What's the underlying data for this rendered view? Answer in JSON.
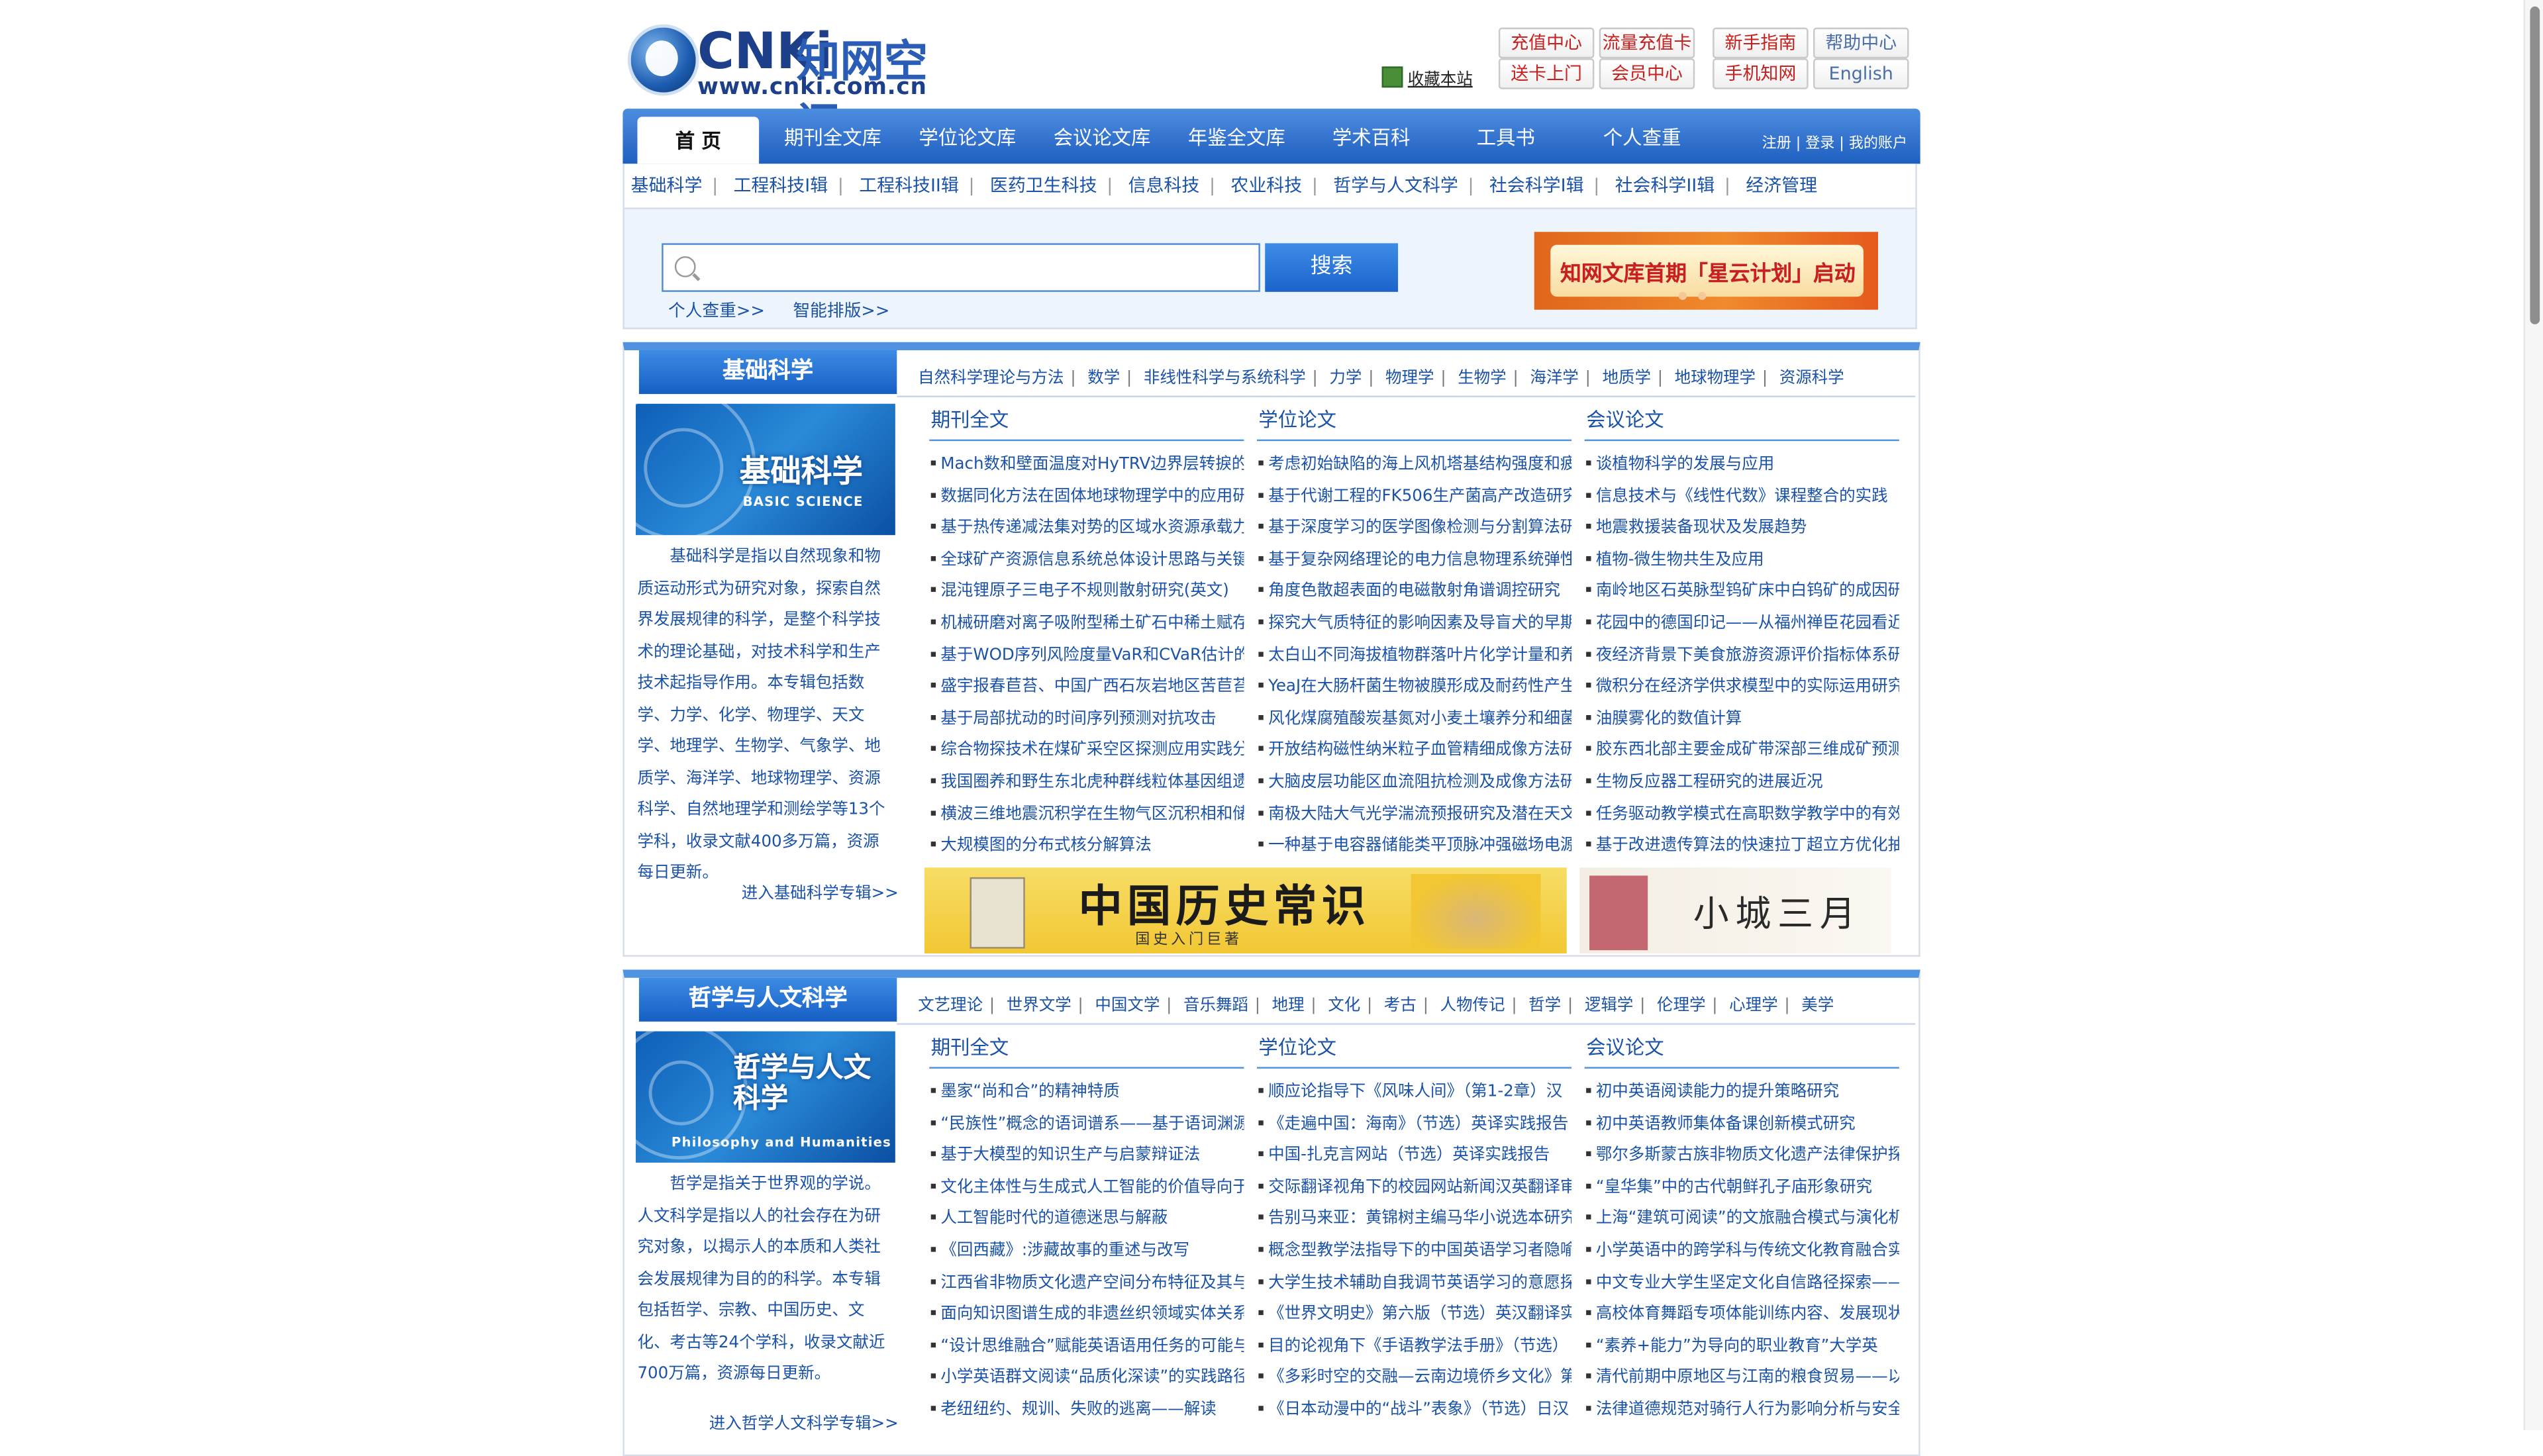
{
  "logo": {
    "word": "CNKi",
    "cn": "知网空间",
    "url": "www.cnki.com.cn"
  },
  "favorite": "收藏本站",
  "top_buttons": [
    {
      "label": "充值中心",
      "style": "red"
    },
    {
      "label": "流量充值卡",
      "style": "red"
    },
    {
      "label": "新手指南",
      "style": "red"
    },
    {
      "label": "帮助中心",
      "style": "blue"
    },
    {
      "label": "送卡上门",
      "style": "red"
    },
    {
      "label": "会员中心",
      "style": "red"
    },
    {
      "label": "手机知网",
      "style": "red"
    },
    {
      "label": "English",
      "style": "blue"
    }
  ],
  "nav": {
    "home": "首 页",
    "items": [
      "期刊全文库",
      "学位论文库",
      "会议论文库",
      "年鉴全文库",
      "学术百科",
      "工具书",
      "个人查重"
    ],
    "register": "注册",
    "login": "登录",
    "account": "我的账户"
  },
  "subnav": [
    "基础科学",
    "工程科技I辑",
    "工程科技II辑",
    "医药卫生科技",
    "信息科技",
    "农业科技",
    "哲学与人文科学",
    "社会科学I辑",
    "社会科学II辑",
    "经济管理"
  ],
  "search": {
    "button": "搜索",
    "links": [
      "个人查重>>",
      "智能排版>>"
    ]
  },
  "banner": {
    "text": "知网文库首期「星云计划」启动"
  },
  "sections": [
    {
      "title": "基础科学",
      "image_title": "基础科学",
      "image_sub": "BASIC SCIENCE",
      "tags": [
        "自然科学理论与方法",
        "数学",
        "非线性科学与系统科学",
        "力学",
        "物理学",
        "生物学",
        "海洋学",
        "地质学",
        "地球物理学",
        "资源科学"
      ],
      "desc": "基础科学是指以自然现象和物质运动形式为研究对象，探索自然界发展规律的科学，是整个科学技术的理论基础，对技术科学和生产技术起指导作用。本专辑包括数学、力学、化学、物理学、天文学、地理学、生物学、气象学、地质学、海洋学、地球物理学、资源科学、自然地理学和测绘学等13个学科，收录文献400多万篇，资源每日更新。",
      "more": "进入基础科学专辑>>",
      "columns": [
        {
          "heading": "期刊全文",
          "items": [
            "Mach数和壁面温度对HyTRV边界层转捩的",
            "数据同化方法在固体地球物理学中的应用研",
            "基于热传递减法集对势的区域水资源承载力",
            "全球矿产资源信息系统总体设计思路与关键",
            "混沌锂原子三电子不规则散射研究(英文)",
            "机械研磨对离子吸附型稀土矿石中稀土赋存",
            "基于WOD序列风险度量VaR和CVaR估计的",
            "盛宇报春苣苔、中国广西石灰岩地区苦苣苔",
            "基于局部扰动的时间序列预测对抗攻击",
            "综合物探技术在煤矿采空区探测应用实践分",
            "我国圈养和野生东北虎种群线粒体基因组遗",
            "横波三维地震沉积学在生物气区沉积相和储",
            "大规模图的分布式核分解算法"
          ]
        },
        {
          "heading": "学位论文",
          "items": [
            "考虑初始缺陷的海上风机塔基结构强度和疲",
            "基于代谢工程的FK506生产菌高产改造研究",
            "基于深度学习的医学图像检测与分割算法研",
            "基于复杂网络理论的电力信息物理系统弹性",
            "角度色散超表面的电磁散射角谱调控研究",
            "探究大气质特征的影响因素及导盲犬的早期",
            "太白山不同海拔植物群落叶片化学计量和养",
            "YeaJ在大肠杆菌生物被膜形成及耐药性产生",
            "风化煤腐殖酸炭基氮对小麦土壤养分和细菌",
            "开放结构磁性纳米粒子血管精细成像方法研",
            "大脑皮层功能区血流阻抗检测及成像方法研",
            "南极大陆大气光学湍流预报研究及潜在天文",
            "一种基于电容器储能类平顶脉冲强磁场电源"
          ]
        },
        {
          "heading": "会议论文",
          "items": [
            "谈植物科学的发展与应用",
            "信息技术与《线性代数》课程整合的实践",
            "地震救援装备现状及发展趋势",
            "植物-微生物共生及应用",
            "南岭地区石英脉型钨矿床中白钨矿的成因研",
            "花园中的德国印记——从福州禅臣花园看近",
            "夜经济背景下美食旅游资源评价指标体系研",
            "微积分在经济学供求模型中的实际运用研究",
            "油膜雾化的数值计算",
            "胶东西北部主要金成矿带深部三维成矿预测",
            "生物反应器工程研究的进展近况",
            "任务驱动教学模式在高职数学教学中的有效",
            "基于改进遗传算法的快速拉丁超立方优化抽"
          ]
        }
      ],
      "ads": [
        {
          "title": "中国历史常识",
          "sub": "国史入门巨著"
        },
        {
          "title": "小城三月"
        }
      ]
    },
    {
      "title": "哲学与人文科学",
      "image_title": "哲学与人文科学",
      "image_sub": "Philosophy and Humanities",
      "tags": [
        "文艺理论",
        "世界文学",
        "中国文学",
        "音乐舞蹈",
        "地理",
        "文化",
        "考古",
        "人物传记",
        "哲学",
        "逻辑学",
        "伦理学",
        "心理学",
        "美学"
      ],
      "desc": "哲学是指关于世界观的学说。人文科学是指以人的社会存在为研究对象，以揭示人的本质和人类社会发展规律为目的的科学。本专辑包括哲学、宗教、中国历史、文化、考古等24个学科，收录文献近700万篇，资源每日更新。",
      "more": "进入哲学人文科学专辑>>",
      "columns": [
        {
          "heading": "期刊全文",
          "items": [
            "墨家“尚和合”的精神特质",
            "“民族性”概念的语词谱系——基于语词渊源",
            "基于大模型的知识生产与启蒙辩证法",
            "文化主体性与生成式人工智能的价值导向于",
            "人工智能时代的道德迷思与解蔽",
            "《回西藏》:涉藏故事的重述与改写",
            "江西省非物质文化遗产空间分布特征及其与",
            "面向知识图谱生成的非遗丝织领域实体关系",
            "“设计思维融合”赋能英语语用任务的可能与",
            "小学英语群文阅读“品质化深读”的实践路径",
            "老纽纽约、规训、失败的逃离——解读"
          ]
        },
        {
          "heading": "学位论文",
          "items": [
            "顺应论指导下《风味人间》（第1-2章）汉",
            "《走遍中国：海南》（节选）英译实践报告",
            "中国-扎克言网站（节选）英译实践报告",
            "交际翻译视角下的校园网站新闻汉英翻译审",
            "告别马来亚：黄锦树主编马华小说选本研究",
            "概念型教学法指导下的中国英语学习者隐喻",
            "大学生技术辅助自我调节英语学习的意愿探",
            "《世界文明史》第六版（节选）英汉翻译实",
            "目的论视角下《手语教学法手册》（节选）",
            "《多彩时空的交融—云南边境侨乡文化》第",
            "《日本动漫中的“战斗”表象》（节选）日汉"
          ]
        },
        {
          "heading": "会议论文",
          "items": [
            "初中英语阅读能力的提升策略研究",
            "初中英语教师集体备课创新模式研究",
            "鄂尔多斯蒙古族非物质文化遗产法律保护探",
            "“皇华集”中的古代朝鲜孔子庙形象研究",
            "上海“建筑可阅读”的文旅融合模式与演化机",
            "小学英语中的跨学科与传统文化教育融合实",
            "中文专业大学生坚定文化自信路径探索——",
            "高校体育舞蹈专项体能训练内容、发展现状",
            "“素养+能力”为导向的职业教育”大学英",
            "清代前期中原地区与江南的粮食贸易——以",
            "法律道德规范对骑行人行为影响分析与安全"
          ]
        }
      ]
    }
  ]
}
